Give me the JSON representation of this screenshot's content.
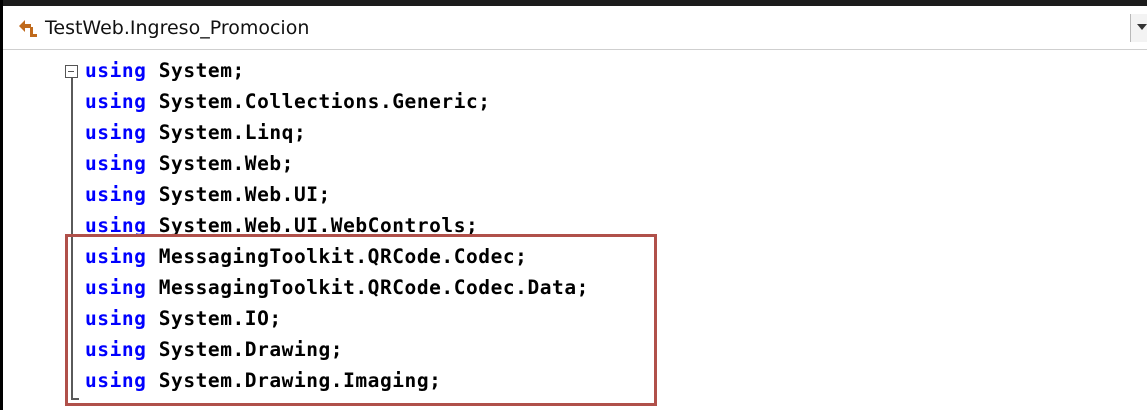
{
  "navbar": {
    "icon": "class-hierarchy-icon",
    "title": "TestWeb.Ingreso_Promocion"
  },
  "colors": {
    "keyword": "#0000ff",
    "identifier": "#000000",
    "highlight_border": "#b0504a"
  },
  "code": {
    "lines": [
      {
        "keyword": "using",
        "namespace": "System;"
      },
      {
        "keyword": "using",
        "namespace": "System.Collections.Generic;"
      },
      {
        "keyword": "using",
        "namespace": "System.Linq;"
      },
      {
        "keyword": "using",
        "namespace": "System.Web;"
      },
      {
        "keyword": "using",
        "namespace": "System.Web.UI;"
      },
      {
        "keyword": "using",
        "namespace": "System.Web.UI.WebControls;"
      },
      {
        "keyword": "using",
        "namespace": "MessagingToolkit.QRCode.Codec;"
      },
      {
        "keyword": "using",
        "namespace": "MessagingToolkit.QRCode.Codec.Data;"
      },
      {
        "keyword": "using",
        "namespace": "System.IO;"
      },
      {
        "keyword": "using",
        "namespace": "System.Drawing;"
      },
      {
        "keyword": "using",
        "namespace": "System.Drawing.Imaging;"
      }
    ]
  }
}
